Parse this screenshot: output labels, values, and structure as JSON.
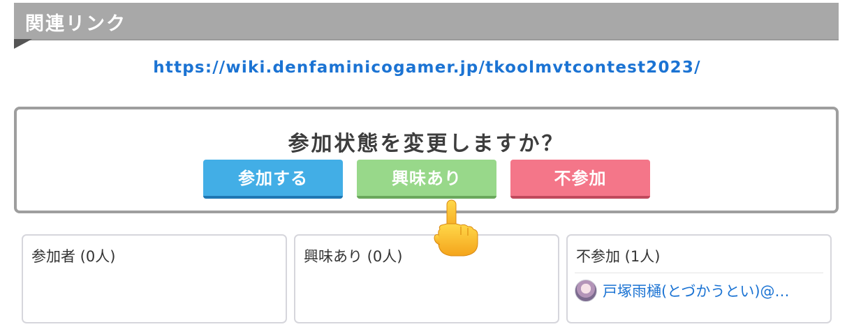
{
  "section": {
    "title": "関連リンク"
  },
  "link": {
    "url": "https://wiki.denfaminicogamer.jp/tkoolmvtcontest2023/"
  },
  "status_prompt": {
    "question": "参加状態を変更しますか？",
    "buttons": {
      "join_label": "参加する",
      "interest_label": "興味あり",
      "decline_label": "不参加"
    },
    "colors": {
      "join": "#42aee6",
      "interest": "#98d88a",
      "decline": "#f47689"
    }
  },
  "columns": [
    {
      "title": "参加者 (0人)",
      "members": []
    },
    {
      "title": "興味あり (0人)",
      "members": []
    },
    {
      "title": "不参加 (1人)",
      "members": [
        {
          "name": "戸塚雨樋(とづかうとい)@…",
          "avatar_icon": "user-avatar-icon"
        }
      ]
    }
  ],
  "cursor": {
    "icon": "pointing-hand-icon"
  }
}
